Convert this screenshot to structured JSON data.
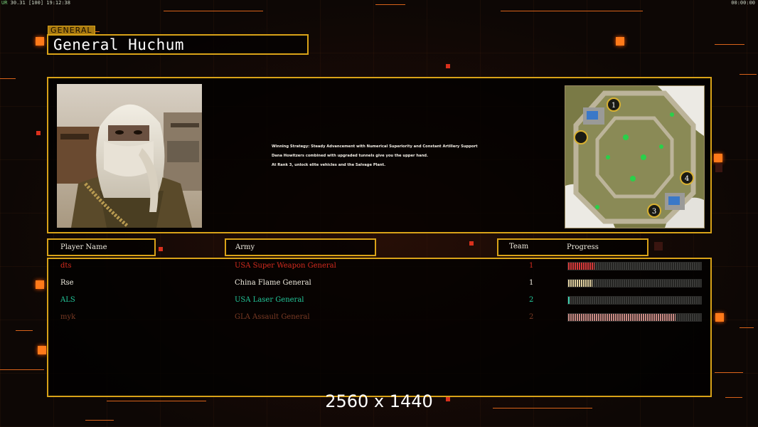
{
  "status_bar": {
    "left_prefix": "UR",
    "left_fps": "30.31",
    "left_cap": "100",
    "left_clock": "19:12:38",
    "right_timer": "00:00:00"
  },
  "general": {
    "tag": "GENERAL",
    "name": "General Huchum"
  },
  "strategy_lines": [
    "Winning Strategy: Steady Advancement with Numerical Superiority and Constant Artillery Support",
    "Dana Howitzers combined with upgraded tunnels give you the upper hand.",
    "At Rank 3, unlock elite vehicles and the Salvage Plant."
  ],
  "minimap": {
    "start_markers": [
      "1",
      "4",
      "3"
    ]
  },
  "columns": {
    "player_name": "Player Name",
    "army": "Army",
    "team": "Team",
    "progress": "Progress"
  },
  "players": [
    {
      "name": "dts",
      "army": "USA Super Weapon General",
      "team": "1",
      "progress": 0.2,
      "color": "#d42a1e",
      "bar_color": "#d83a3a"
    },
    {
      "name": "Rse",
      "army": "China Flame General",
      "team": "1",
      "progress": 0.18,
      "color": "#f0ece0",
      "bar_color": "#e0cfa0"
    },
    {
      "name": "ALS",
      "army": "USA Laser General",
      "team": "2",
      "progress": 0.01,
      "color": "#23c79a",
      "bar_color": "#40d0b0"
    },
    {
      "name": "myk",
      "army": "GLA Assault General",
      "team": "2",
      "progress": 0.81,
      "color": "#7a3a24",
      "bar_color": "#c88a84"
    }
  ],
  "resolution": "2560 x 1440"
}
